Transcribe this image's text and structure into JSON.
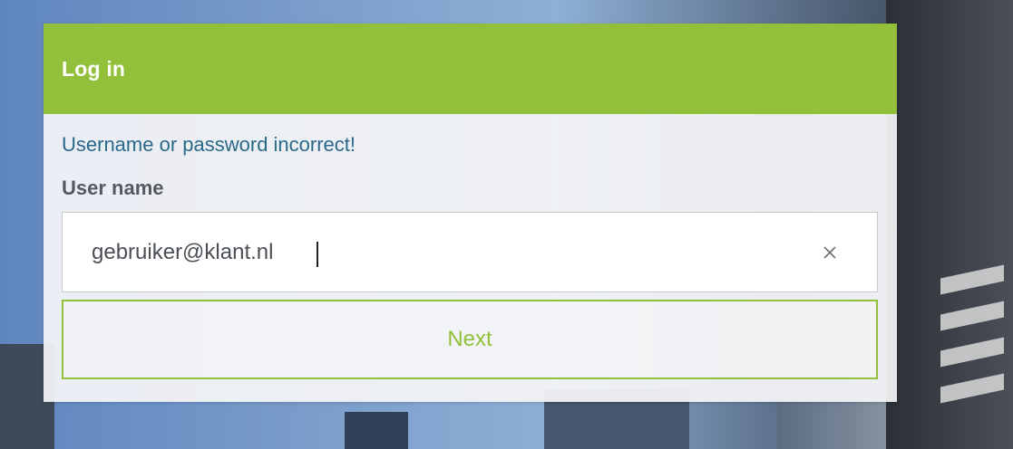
{
  "dialog": {
    "title": "Log in",
    "error_message": "Username or password incorrect!",
    "username_label": "User name",
    "username_value": "gebruiker@klant.nl",
    "clear_icon": "close-icon",
    "next_label": "Next"
  },
  "colors": {
    "accent": "#93c03b",
    "error_text": "#2a6a88",
    "label_text": "#555a60"
  }
}
